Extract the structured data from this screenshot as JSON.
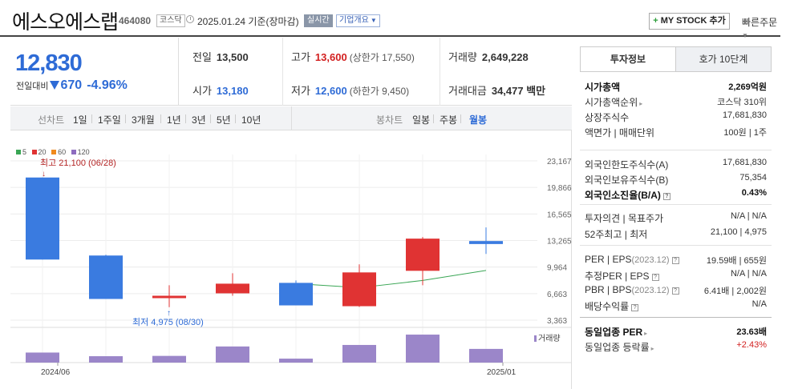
{
  "header": {
    "name": "에스오에스랩",
    "code": "464080",
    "market": "코스닥",
    "date": "2025.01.24",
    "date_suffix": "기준(장마감)",
    "live_badge": "실시간",
    "overview_badge": "기업개요",
    "mystock_label": "MY STOCK 추가",
    "quick_order": "빠른주문"
  },
  "price": {
    "current": "12,830",
    "change_label": "전일대비",
    "change_value": "670",
    "change_rate": "-4.96%",
    "colors": {
      "down": "#2e6bd6",
      "up": "#d21f1f"
    }
  },
  "stats": {
    "prev_close_label": "전일",
    "prev_close": "13,500",
    "high_label": "고가",
    "high": "13,600",
    "upper_limit": "(상한가 17,550)",
    "volume_label": "거래량",
    "volume": "2,649,228",
    "open_label": "시가",
    "open": "13,180",
    "low_label": "저가",
    "low": "12,600",
    "lower_limit": "(하한가 9,450)",
    "amount_label": "거래대금",
    "amount": "34,477 백만"
  },
  "period_bar": {
    "line_label": "선차트",
    "line_items": [
      "1일",
      "1주일",
      "3개월",
      "1년",
      "3년",
      "5년",
      "10년"
    ],
    "candle_label": "봉차트",
    "candle_items": [
      "일봉",
      "주봉",
      "월봉"
    ],
    "active_candle": "월봉"
  },
  "legend": [
    {
      "label": "5",
      "color": "#3aa655"
    },
    {
      "label": "20",
      "color": "#e03333"
    },
    {
      "label": "60",
      "color": "#f08a1d"
    },
    {
      "label": "120",
      "color": "#8e6cbf"
    }
  ],
  "chart_data": {
    "type": "candlestick",
    "x_labels": [
      "2024/06",
      "2025/01"
    ],
    "y_ticks": [
      "23,167",
      "19,866",
      "16,565",
      "13,265",
      "9,964",
      "6,663",
      "3,363"
    ],
    "ylim": [
      3363,
      23167
    ],
    "candles": [
      {
        "open": 10900,
        "high": 21100,
        "low": 10900,
        "close": 21100,
        "color": "#3a7be0"
      },
      {
        "open": 11400,
        "high": 11500,
        "low": 6000,
        "close": 6000,
        "color": "#3a7be0"
      },
      {
        "open": 6100,
        "high": 7700,
        "low": 4975,
        "close": 6400,
        "color": "#e03333"
      },
      {
        "open": 6700,
        "high": 9200,
        "low": 6400,
        "close": 7900,
        "color": "#e03333"
      },
      {
        "open": 8000,
        "high": 8300,
        "low": 5200,
        "close": 5200,
        "color": "#3a7be0"
      },
      {
        "open": 5100,
        "high": 10300,
        "low": 5000,
        "close": 9300,
        "color": "#e03333"
      },
      {
        "open": 9500,
        "high": 13700,
        "low": 7700,
        "close": 13500,
        "color": "#e03333"
      },
      {
        "open": 13200,
        "high": 14900,
        "low": 11600,
        "close": 12830,
        "color": "#3a7be0"
      }
    ],
    "ma5": {
      "color": "#3aa655",
      "points": [
        [
          4,
          7900
        ],
        [
          5,
          7400
        ],
        [
          6,
          8300
        ],
        [
          7,
          9550
        ]
      ]
    },
    "max_annotation": "최고 21,100 (06/28)",
    "min_annotation": "최저 4,975 (08/30)",
    "volume_label": "거래량",
    "volume_color": "#9b86c9",
    "volumes": [
      0.33,
      0.21,
      0.22,
      0.53,
      0.13,
      0.58,
      0.92,
      0.45
    ]
  },
  "invest": {
    "tab_info": "투자정보",
    "tab_quote": "호가 10단계",
    "groups": [
      [
        {
          "k": "시가총액",
          "v": "2,269억원",
          "bold": true
        },
        {
          "k": "시가총액순위",
          "v": "코스닥 310위",
          "arrow": true
        },
        {
          "k": "상장주식수",
          "v": "17,681,830"
        },
        {
          "k": "액면가 | 매매단위",
          "v": "100원 | 1주"
        }
      ],
      [
        {
          "k": "외국인한도주식수(A)",
          "v": "17,681,830"
        },
        {
          "k": "외국인보유주식수(B)",
          "v": "75,354"
        },
        {
          "k": "외국인소진율(B/A)",
          "v": "0.43%",
          "bold": true,
          "q": true
        }
      ],
      [
        {
          "k": "투자의견 | 목표주가",
          "v": "N/A | N/A"
        },
        {
          "k": "52주최고 | 최저",
          "v": "21,100 | 4,975"
        }
      ],
      [
        {
          "k": "PER | EPS",
          "dim": "(2023.12)",
          "v": "19.59배 | 655원",
          "q": true
        },
        {
          "k": "추정PER | EPS",
          "v": "N/A | N/A",
          "q": true
        },
        {
          "k": "PBR | BPS",
          "dim": "(2023.12)",
          "v": "6.41배 | 2,002원",
          "q": true
        },
        {
          "k": "배당수익률",
          "v": "N/A",
          "q": true
        }
      ],
      [
        {
          "k": "동일업종 PER",
          "v": "23.63배",
          "bold": true,
          "arrow": true
        },
        {
          "k": "동일업종 등락률",
          "v": "+2.43%",
          "arrow": true,
          "red": true
        }
      ]
    ]
  }
}
